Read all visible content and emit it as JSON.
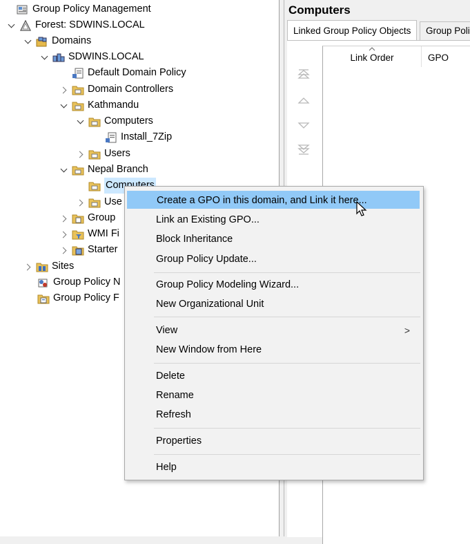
{
  "tree": {
    "items": [
      {
        "label": "Group Policy Management",
        "icon": "gpm-console-icon"
      },
      {
        "label": "Forest: SDWINS.LOCAL",
        "icon": "forest-icon"
      },
      {
        "label": "Domains",
        "icon": "domains-icon"
      },
      {
        "label": "SDWINS.LOCAL",
        "icon": "domain-icon"
      },
      {
        "label": "Default Domain Policy",
        "icon": "gpo-link-icon"
      },
      {
        "label": "Domain Controllers",
        "icon": "ou-folder-icon"
      },
      {
        "label": "Kathmandu",
        "icon": "ou-folder-icon"
      },
      {
        "label": "Computers",
        "icon": "ou-folder-icon"
      },
      {
        "label": "Install_7Zip",
        "icon": "gpo-link-icon"
      },
      {
        "label": "Users",
        "icon": "ou-folder-icon"
      },
      {
        "label": "Nepal Branch",
        "icon": "ou-folder-icon"
      },
      {
        "label": "Computers",
        "icon": "ou-folder-icon"
      },
      {
        "label": "Use",
        "icon": "ou-folder-icon"
      },
      {
        "label": "Group",
        "icon": "gpo-objects-folder-icon"
      },
      {
        "label": "WMI Fi",
        "icon": "wmi-filters-folder-icon"
      },
      {
        "label": "Starter",
        "icon": "starter-gpo-folder-icon"
      },
      {
        "label": "Sites",
        "icon": "sites-icon"
      },
      {
        "label": "Group Policy N",
        "icon": "modeling-icon"
      },
      {
        "label": "Group Policy F",
        "icon": "results-icon"
      }
    ]
  },
  "right_pane": {
    "title": "Computers",
    "tabs": [
      "Linked Group Policy Objects",
      "Group Polic"
    ],
    "columns": [
      "Link Order",
      "GPO"
    ]
  },
  "context_menu": {
    "items": [
      "Create a GPO in this domain, and Link it here...",
      "Link an Existing GPO...",
      "Block Inheritance",
      "Group Policy Update...",
      "Group Policy Modeling Wizard...",
      "New Organizational Unit",
      "View",
      "New Window from Here",
      "Delete",
      "Rename",
      "Refresh",
      "Properties",
      "Help"
    ],
    "view_submenu_arrow": ">",
    "highlight_color": "#91c9f7"
  }
}
